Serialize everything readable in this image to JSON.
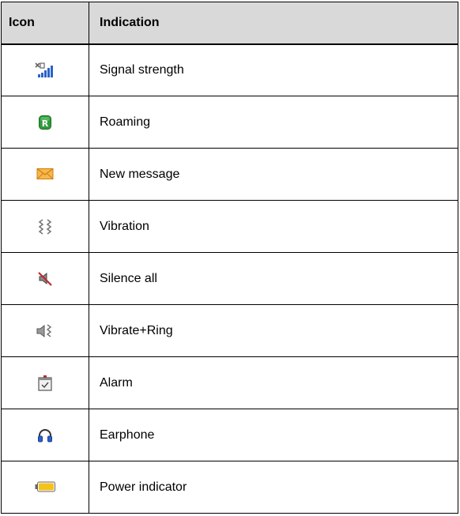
{
  "table": {
    "headers": {
      "icon": "Icon",
      "indication": "Indication"
    },
    "rows": [
      {
        "icon": "signal-strength-icon",
        "indication": "Signal strength"
      },
      {
        "icon": "roaming-icon",
        "indication": "Roaming"
      },
      {
        "icon": "new-message-icon",
        "indication": "New message"
      },
      {
        "icon": "vibration-icon",
        "indication": "Vibration"
      },
      {
        "icon": "silence-all-icon",
        "indication": "Silence all"
      },
      {
        "icon": "vibrate-ring-icon",
        "indication": "Vibrate+Ring"
      },
      {
        "icon": "alarm-icon",
        "indication": "Alarm"
      },
      {
        "icon": "earphone-icon",
        "indication": "Earphone"
      },
      {
        "icon": "power-indicator-icon",
        "indication": "Power indicator"
      }
    ]
  },
  "colors": {
    "header_bg": "#d9d9d9",
    "border": "#000000",
    "signal_bars": "#2b62c8",
    "roaming_green": "#2f9a3a",
    "message_orange": "#f0a024",
    "silence_red": "#c0282c",
    "battery_yellow": "#f5c21c"
  }
}
